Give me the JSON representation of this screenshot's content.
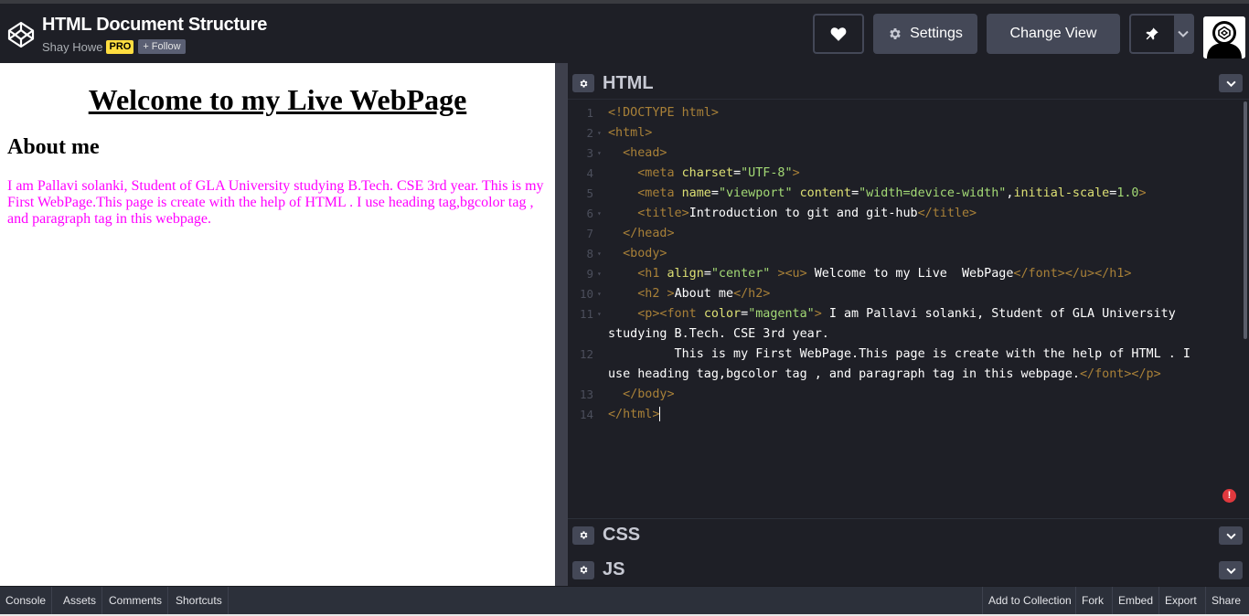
{
  "header": {
    "title": "HTML Document Structure",
    "author": "Shay Howe",
    "pro_badge": "PRO",
    "follow_label": "+ Follow",
    "settings_label": "Settings",
    "change_view_label": "Change View"
  },
  "preview": {
    "heading": "Welcome to my Live WebPage",
    "subheading": "About me",
    "paragraph": "I am Pallavi solanki, Student of GLA University studying B.Tech. CSE 3rd year. This is my First WebPage.This page is create with the help of HTML . I use heading tag,bgcolor tag , and paragraph tag in this webpage.",
    "paragraph_color": "#ff00ff"
  },
  "panels": {
    "html_title": "HTML",
    "css_title": "CSS",
    "js_title": "JS"
  },
  "code": {
    "line_numbers": [
      "1",
      "2",
      "3",
      "4",
      "5",
      "6",
      "7",
      "8",
      "9",
      "10",
      "11",
      "",
      "12",
      "",
      "13",
      "14"
    ],
    "lines": [
      {
        "parts": [
          [
            "t",
            "<!DOCTYPE html>"
          ]
        ]
      },
      {
        "parts": [
          [
            "t",
            "<html>"
          ]
        ]
      },
      {
        "parts": [
          [
            "p",
            "  "
          ],
          [
            "t",
            "<head>"
          ]
        ]
      },
      {
        "parts": [
          [
            "p",
            "    "
          ],
          [
            "t",
            "<meta "
          ],
          [
            "a",
            "charset"
          ],
          [
            "p",
            "="
          ],
          [
            "s",
            "\"UTF-8\""
          ],
          [
            "t",
            ">"
          ]
        ]
      },
      {
        "parts": [
          [
            "p",
            "    "
          ],
          [
            "t",
            "<meta "
          ],
          [
            "a",
            "name"
          ],
          [
            "p",
            "="
          ],
          [
            "s",
            "\"viewport\""
          ],
          [
            "p",
            " "
          ],
          [
            "a",
            "content"
          ],
          [
            "p",
            "="
          ],
          [
            "s",
            "\"width=device-width\""
          ],
          [
            "p",
            ","
          ],
          [
            "a",
            "initial-scale"
          ],
          [
            "p",
            "="
          ],
          [
            "s",
            "1.0"
          ],
          [
            "t",
            ">"
          ]
        ]
      },
      {
        "parts": [
          [
            "p",
            "    "
          ],
          [
            "t",
            "<title>"
          ],
          [
            "p",
            "Introduction to git and git-hub"
          ],
          [
            "t",
            "</title>"
          ]
        ]
      },
      {
        "parts": [
          [
            "p",
            "  "
          ],
          [
            "t",
            "</head>"
          ]
        ]
      },
      {
        "parts": [
          [
            "p",
            "  "
          ],
          [
            "t",
            "<body>"
          ]
        ]
      },
      {
        "parts": [
          [
            "p",
            "    "
          ],
          [
            "t",
            "<h1 "
          ],
          [
            "a",
            "align"
          ],
          [
            "p",
            "="
          ],
          [
            "s",
            "\"center\""
          ],
          [
            "p",
            " "
          ],
          [
            "t",
            "><u>"
          ],
          [
            "p",
            " Welcome to my Live  WebPage"
          ],
          [
            "t",
            "</font></u></h1>"
          ]
        ]
      },
      {
        "parts": [
          [
            "p",
            "    "
          ],
          [
            "t",
            "<h2 >"
          ],
          [
            "p",
            "About me"
          ],
          [
            "t",
            "</h2>"
          ]
        ]
      },
      {
        "parts": [
          [
            "p",
            "    "
          ],
          [
            "t",
            "<p><font "
          ],
          [
            "a",
            "color"
          ],
          [
            "p",
            "="
          ],
          [
            "s",
            "\"magenta\""
          ],
          [
            "t",
            ">"
          ],
          [
            "p",
            " I am Pallavi solanki, Student of GLA University"
          ]
        ]
      },
      {
        "parts": [
          [
            "p",
            "studying B.Tech. CSE 3rd year."
          ]
        ]
      },
      {
        "parts": [
          [
            "p",
            "         This is my First WebPage.This page is create with the help of HTML . I"
          ]
        ]
      },
      {
        "parts": [
          [
            "p",
            "use heading tag,bgcolor tag , and paragraph tag in this webpage."
          ],
          [
            "t",
            "</font></p>"
          ]
        ]
      },
      {
        "parts": [
          [
            "p",
            "  "
          ],
          [
            "t",
            "</body>"
          ]
        ]
      },
      {
        "parts": [
          [
            "t",
            "</html>"
          ]
        ]
      }
    ],
    "fold_lines": [
      1,
      2,
      5,
      7,
      8,
      9,
      10
    ],
    "error_badge": "!"
  },
  "footer": {
    "left": [
      "Console",
      "Assets",
      "Comments",
      "Shortcuts"
    ],
    "right": [
      "Add to Collection",
      "Fork",
      "Embed",
      "Export",
      "Share"
    ]
  },
  "icons": {
    "logo": "codepen-logo-icon",
    "heart": "heart-icon",
    "settings": "gear-icon",
    "pin": "pin-icon",
    "chevron": "chevron-down-icon",
    "avatar": "codepen-avatar-icon"
  },
  "colors": {
    "background": "#1e1f26",
    "button": "#444857",
    "tag": "#a88038",
    "attribute": "#dde074",
    "string": "#a3d975",
    "pro_badge": "#ffdd40"
  }
}
